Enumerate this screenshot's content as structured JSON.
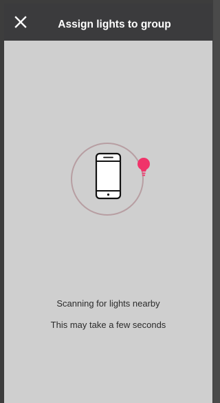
{
  "header": {
    "title": "Assign lights to group",
    "close_icon": "close-icon"
  },
  "scan": {
    "phone_icon": "smartphone-icon",
    "bulb_icon": "lightbulb-icon",
    "bulb_color": "#f0346a",
    "ring_color": "#b79ea2"
  },
  "status": {
    "line1": "Scanning for lights nearby",
    "line2": "This may take a few seconds"
  },
  "colors": {
    "header_bg": "#3b3b3d",
    "content_bg": "#cfcfcf"
  }
}
